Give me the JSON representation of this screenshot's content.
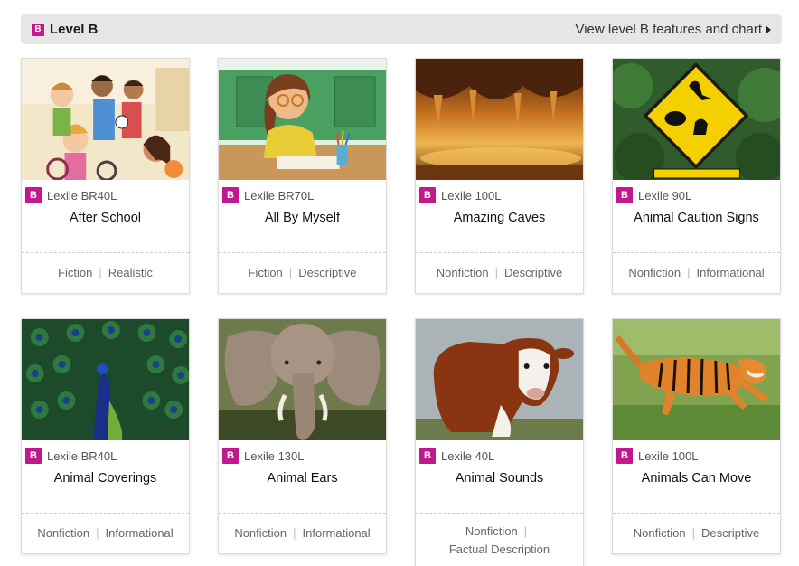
{
  "level": {
    "badge": "B",
    "title": "Level B",
    "link_label": "View level B features and chart",
    "badge_color": "#c2188e"
  },
  "books": [
    {
      "badge": "B",
      "lexile": "Lexile BR40L",
      "title": "After School",
      "genre": "Fiction",
      "type": "Realistic",
      "image": "kids-bikes-illustration"
    },
    {
      "badge": "B",
      "lexile": "Lexile BR70L",
      "title": "All By Myself",
      "genre": "Fiction",
      "type": "Descriptive",
      "image": "girl-drawing-illustration"
    },
    {
      "badge": "B",
      "lexile": "Lexile 100L",
      "title": "Amazing Caves",
      "genre": "Nonfiction",
      "type": "Descriptive",
      "image": "cave-photo"
    },
    {
      "badge": "B",
      "lexile": "Lexile 90L",
      "title": "Animal Caution Signs",
      "genre": "Nonfiction",
      "type": "Informational",
      "image": "kangaroo-sign-photo"
    },
    {
      "badge": "B",
      "lexile": "Lexile BR40L",
      "title": "Animal Coverings",
      "genre": "Nonfiction",
      "type": "Informational",
      "image": "peacock-photo"
    },
    {
      "badge": "B",
      "lexile": "Lexile 130L",
      "title": "Animal Ears",
      "genre": "Nonfiction",
      "type": "Informational",
      "image": "elephant-photo"
    },
    {
      "badge": "B",
      "lexile": "Lexile 40L",
      "title": "Animal Sounds",
      "genre": "Nonfiction",
      "type": "Factual Description",
      "image": "cow-photo"
    },
    {
      "badge": "B",
      "lexile": "Lexile 100L",
      "title": "Animals Can Move",
      "genre": "Nonfiction",
      "type": "Descriptive",
      "image": "tiger-photo"
    }
  ]
}
